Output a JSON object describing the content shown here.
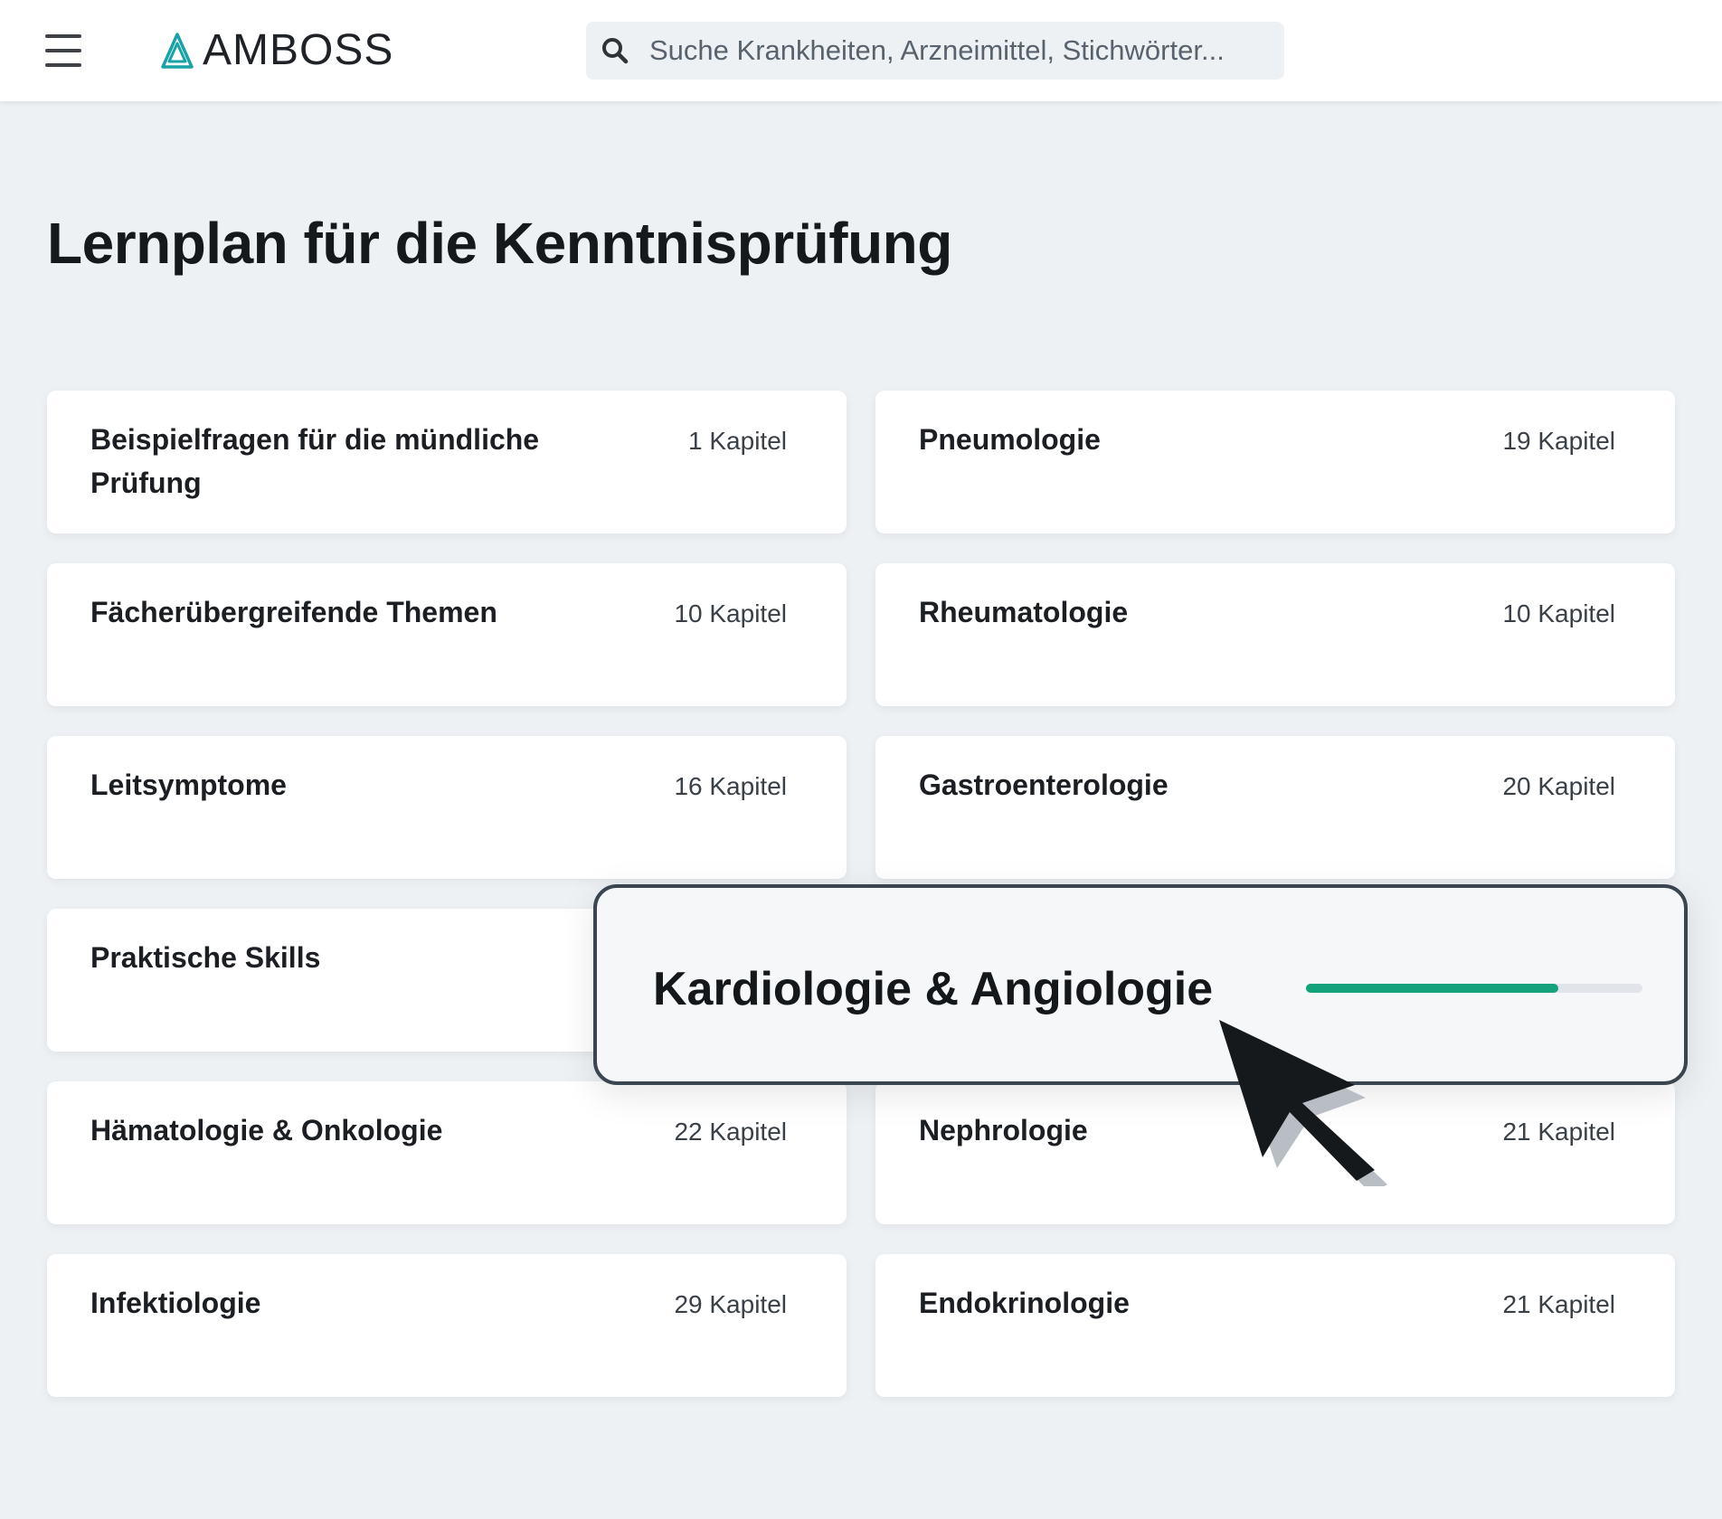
{
  "header": {
    "logo_text": "AMBOSS",
    "search_placeholder": "Suche Krankheiten, Arzneimittel, Stichwörter..."
  },
  "page": {
    "title": "Lernplan für die Kenntnisprüfung"
  },
  "cards": [
    {
      "title": "Beispielfragen für die mündliche Prüfung",
      "count": "1 Kapitel"
    },
    {
      "title": "Pneumologie",
      "count": "19 Kapitel"
    },
    {
      "title": "Fächerübergreifende Themen",
      "count": "10 Kapitel"
    },
    {
      "title": "Rheumatologie",
      "count": "10 Kapitel"
    },
    {
      "title": "Leitsymptome",
      "count": "16 Kapitel"
    },
    {
      "title": "Gastroenterologie",
      "count": "20 Kapitel"
    },
    {
      "title": "Praktische Skills",
      "count": ""
    },
    {
      "title": "Hämatologie & Onkologie",
      "count": "22 Kapitel"
    },
    {
      "title": "Nephrologie",
      "count": "21 Kapitel"
    },
    {
      "title": "Infektiologie",
      "count": "29 Kapitel"
    },
    {
      "title": "Endokrinologie",
      "count": "21 Kapitel"
    }
  ],
  "highlight_card": {
    "title": "Kardiologie & Angiologie",
    "progress": 0.75
  },
  "colors": {
    "accent": "#14a27a",
    "logo": "#1aa3a6",
    "background": "#eef1f4"
  },
  "icons": {
    "menu": "hamburger-menu-icon",
    "search": "search-icon",
    "logo": "amboss-triangle-logo-icon",
    "cursor": "mouse-pointer-icon"
  }
}
